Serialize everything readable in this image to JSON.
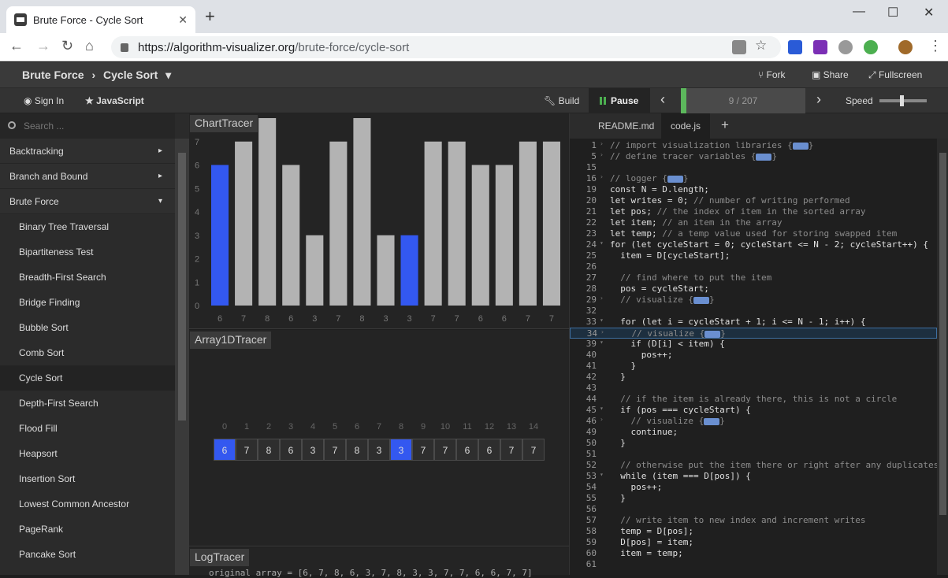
{
  "browser": {
    "tab_title": "Brute Force - Cycle Sort",
    "url_host": "https://algorithm-visualizer.org",
    "url_path": "/brute-force/cycle-sort",
    "new_tab": "+",
    "close_tab": "✕",
    "minimize": "—",
    "maximize": "☐",
    "close": "✕"
  },
  "header": {
    "crumb_category": "Brute Force",
    "crumb_sep": "›",
    "crumb_algorithm": "Cycle Sort",
    "crumb_caret": "▾",
    "fork": "Fork",
    "share": "Share",
    "fullscreen": "Fullscreen"
  },
  "toolbar": {
    "sign_in": "Sign In",
    "language": "JavaScript",
    "build": "Build",
    "pause": "Pause",
    "prev": "‹",
    "next": "›",
    "progress_current": "9",
    "progress_total": "/ 207",
    "progress_fraction": 0.0435,
    "speed": "Speed"
  },
  "sidebar": {
    "search_placeholder": "Search ...",
    "categories": [
      {
        "label": "Backtracking",
        "arrow": "▸"
      },
      {
        "label": "Branch and Bound",
        "arrow": "▸"
      },
      {
        "label": "Brute Force",
        "arrow": "▾"
      }
    ],
    "items": [
      "Binary Tree Traversal",
      "Bipartiteness Test",
      "Breadth-First Search",
      "Bridge Finding",
      "Bubble Sort",
      "Comb Sort",
      "Cycle Sort",
      "Depth-First Search",
      "Flood Fill",
      "Heapsort",
      "Insertion Sort",
      "Lowest Common Ancestor",
      "PageRank",
      "Pancake Sort"
    ],
    "active_item": "Cycle Sort"
  },
  "chart_tracer": {
    "label": "ChartTracer",
    "chart_data": {
      "type": "bar",
      "categories": [
        "6",
        "7",
        "8",
        "6",
        "3",
        "7",
        "8",
        "3",
        "3",
        "7",
        "7",
        "6",
        "6",
        "7",
        "7"
      ],
      "values": [
        6,
        7,
        8,
        6,
        3,
        7,
        8,
        3,
        3,
        7,
        7,
        6,
        6,
        7,
        7
      ],
      "highlighted": [
        0,
        8
      ],
      "ylim": [
        0,
        8
      ],
      "yticks": [
        "0",
        "1",
        "2",
        "3",
        "4",
        "5",
        "6",
        "7"
      ],
      "bar_color": "#b3b3b3",
      "highlight_color": "#3358f0"
    }
  },
  "array_tracer": {
    "label": "Array1DTracer",
    "indices": [
      "0",
      "1",
      "2",
      "3",
      "4",
      "5",
      "6",
      "7",
      "8",
      "9",
      "10",
      "11",
      "12",
      "13",
      "14"
    ],
    "values": [
      "6",
      "7",
      "8",
      "6",
      "3",
      "7",
      "8",
      "3",
      "3",
      "7",
      "7",
      "6",
      "6",
      "7",
      "7"
    ],
    "highlighted": [
      0,
      8
    ]
  },
  "log_tracer": {
    "label": "LogTracer",
    "line": "original array = [6, 7, 8, 6, 3, 7, 8, 3, 3, 7, 7, 6, 6, 7, 7]"
  },
  "editor": {
    "tabs": [
      "README.md",
      "code.js"
    ],
    "active_tab": "code.js",
    "add_tab": "+",
    "lines": [
      {
        "n": "1",
        "fold": "›",
        "text": "// import visualization libraries {",
        "c": 1,
        "f": 1,
        "after": "}"
      },
      {
        "n": "5",
        "fold": "›",
        "text": "// define tracer variables {",
        "c": 1,
        "f": 1,
        "after": "}"
      },
      {
        "n": "15",
        "fold": "",
        "text": ""
      },
      {
        "n": "16",
        "fold": "›",
        "text": "// logger {",
        "c": 1,
        "f": 1,
        "after": "}"
      },
      {
        "n": "19",
        "fold": "",
        "text": "const N = D.length;"
      },
      {
        "n": "20",
        "fold": "",
        "text": "let writes = 0; // number of writing performed"
      },
      {
        "n": "21",
        "fold": "",
        "text": "let pos; // the index of item in the sorted array"
      },
      {
        "n": "22",
        "fold": "",
        "text": "let item; // an item in the array"
      },
      {
        "n": "23",
        "fold": "",
        "text": "let temp; // a temp value used for storing swapped item"
      },
      {
        "n": "24",
        "fold": "▾",
        "text": "for (let cycleStart = 0; cycleStart <= N - 2; cycleStart++) {"
      },
      {
        "n": "25",
        "fold": "",
        "text": "  item = D[cycleStart];"
      },
      {
        "n": "26",
        "fold": "",
        "text": ""
      },
      {
        "n": "27",
        "fold": "",
        "text": "  // find where to put the item",
        "c": 1
      },
      {
        "n": "28",
        "fold": "",
        "text": "  pos = cycleStart;"
      },
      {
        "n": "29",
        "fold": "›",
        "text": "  // visualize {",
        "c": 1,
        "f": 1,
        "after": "}"
      },
      {
        "n": "32",
        "fold": "",
        "text": ""
      },
      {
        "n": "33",
        "fold": "▾",
        "text": "  for (let i = cycleStart + 1; i <= N - 1; i++) {"
      },
      {
        "n": "34",
        "fold": "›",
        "text": "    // visualize {",
        "c": 1,
        "f": 1,
        "after": "}",
        "hl": 1
      },
      {
        "n": "39",
        "fold": "▾",
        "text": "    if (D[i] < item) {"
      },
      {
        "n": "40",
        "fold": "",
        "text": "      pos++;"
      },
      {
        "n": "41",
        "fold": "",
        "text": "    }"
      },
      {
        "n": "42",
        "fold": "",
        "text": "  }"
      },
      {
        "n": "43",
        "fold": "",
        "text": ""
      },
      {
        "n": "44",
        "fold": "",
        "text": "  // if the item is already there, this is not a circle",
        "c": 1
      },
      {
        "n": "45",
        "fold": "▾",
        "text": "  if (pos === cycleStart) {"
      },
      {
        "n": "46",
        "fold": "›",
        "text": "    // visualize {",
        "c": 1,
        "f": 1,
        "after": "}"
      },
      {
        "n": "49",
        "fold": "",
        "text": "    continue;"
      },
      {
        "n": "50",
        "fold": "",
        "text": "  }"
      },
      {
        "n": "51",
        "fold": "",
        "text": ""
      },
      {
        "n": "52",
        "fold": "",
        "text": "  // otherwise put the item there or right after any duplicates",
        "c": 1
      },
      {
        "n": "53",
        "fold": "▾",
        "text": "  while (item === D[pos]) {"
      },
      {
        "n": "54",
        "fold": "",
        "text": "    pos++;"
      },
      {
        "n": "55",
        "fold": "",
        "text": "  }"
      },
      {
        "n": "56",
        "fold": "",
        "text": ""
      },
      {
        "n": "57",
        "fold": "",
        "text": "  // write item to new index and increment writes",
        "c": 1
      },
      {
        "n": "58",
        "fold": "",
        "text": "  temp = D[pos];"
      },
      {
        "n": "59",
        "fold": "",
        "text": "  D[pos] = item;"
      },
      {
        "n": "60",
        "fold": "",
        "text": "  item = temp;"
      },
      {
        "n": "61",
        "fold": "",
        "text": ""
      }
    ]
  }
}
